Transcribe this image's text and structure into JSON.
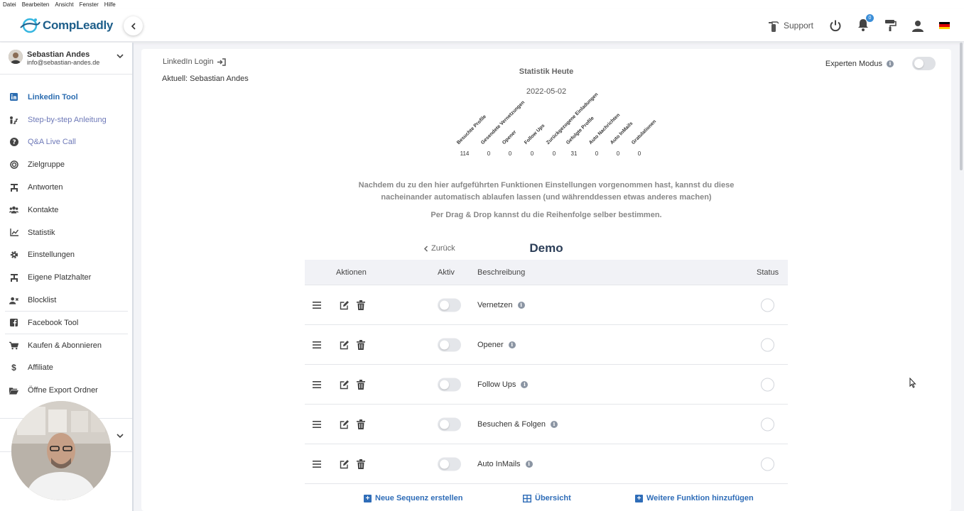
{
  "menubar": [
    "Datei",
    "Bearbeiten",
    "Ansicht",
    "Fenster",
    "Hilfe"
  ],
  "app": {
    "logo_text": "CompLeadly"
  },
  "topbar": {
    "support_label": "Support",
    "notification_count": "0"
  },
  "user": {
    "name": "Sebastian Andes",
    "email": "info@sebastian-andes.de"
  },
  "sidebar": {
    "items": [
      {
        "label": "Linkedin Tool",
        "icon": "linkedin-icon"
      },
      {
        "label": "Step-by-step Anleitung",
        "icon": "steps-icon"
      },
      {
        "label": "Q&A Live Call",
        "icon": "question-icon"
      },
      {
        "label": "Zielgruppe",
        "icon": "target-icon"
      },
      {
        "label": "Antworten",
        "icon": "reply-icon"
      },
      {
        "label": "Kontakte",
        "icon": "contacts-icon"
      },
      {
        "label": "Statistik",
        "icon": "chart-icon"
      },
      {
        "label": "Einstellungen",
        "icon": "gear-icon"
      },
      {
        "label": "Eigene Platzhalter",
        "icon": "placeholder-icon"
      },
      {
        "label": "Blocklist",
        "icon": "block-icon"
      },
      {
        "label": "Facebook Tool",
        "icon": "facebook-icon"
      },
      {
        "label": "Kaufen & Abonnieren",
        "icon": "cart-icon"
      },
      {
        "label": "Affiliate",
        "icon": "dollar-icon"
      },
      {
        "label": "Öffne Export Ordner",
        "icon": "folder-icon"
      }
    ]
  },
  "main": {
    "linkedin_login": "LinkedIn Login",
    "current_user": "Aktuell: Sebastian Andes",
    "expert_mode": "Experten Modus",
    "stats_title": "Statistik Heute",
    "stats_date": "2022-05-02",
    "stats": [
      {
        "label": "Besuchte Profile",
        "value": "114"
      },
      {
        "label": "Gesendete Vernetzungen",
        "value": "0"
      },
      {
        "label": "Opener",
        "value": "0"
      },
      {
        "label": "Follow Ups",
        "value": "0"
      },
      {
        "label": "Zurückgezogene Einladungen",
        "value": "0"
      },
      {
        "label": "Gefolgte Profile",
        "value": "31"
      },
      {
        "label": "Auto Nachrichten",
        "value": "0"
      },
      {
        "label": "Auto InMails",
        "value": "0"
      },
      {
        "label": "Gratulationen",
        "value": "0"
      }
    ],
    "description_line1": "Nachdem du zu den hier aufgeführten Funktionen Einstellungen vorgenommen hast, kannst du diese",
    "description_line2": "nacheinander automatisch ablaufen lassen (und währenddessen etwas anderes machen)",
    "description_drag": "Per Drag & Drop kannst du die Reihenfolge selber bestimmen.",
    "back_label": "Zurück",
    "sequence_title": "Demo",
    "table_headers": {
      "actions": "Aktionen",
      "active": "Aktiv",
      "description": "Beschreibung",
      "status": "Status"
    },
    "rows": [
      {
        "description": "Vernetzen"
      },
      {
        "description": "Opener"
      },
      {
        "description": "Follow Ups"
      },
      {
        "description": "Besuchen & Folgen"
      },
      {
        "description": "Auto InMails"
      }
    ],
    "footer": {
      "new_sequence": "Neue Sequenz erstellen",
      "overview": "Übersicht",
      "add_function": "Weitere Funktion hinzufügen"
    }
  }
}
